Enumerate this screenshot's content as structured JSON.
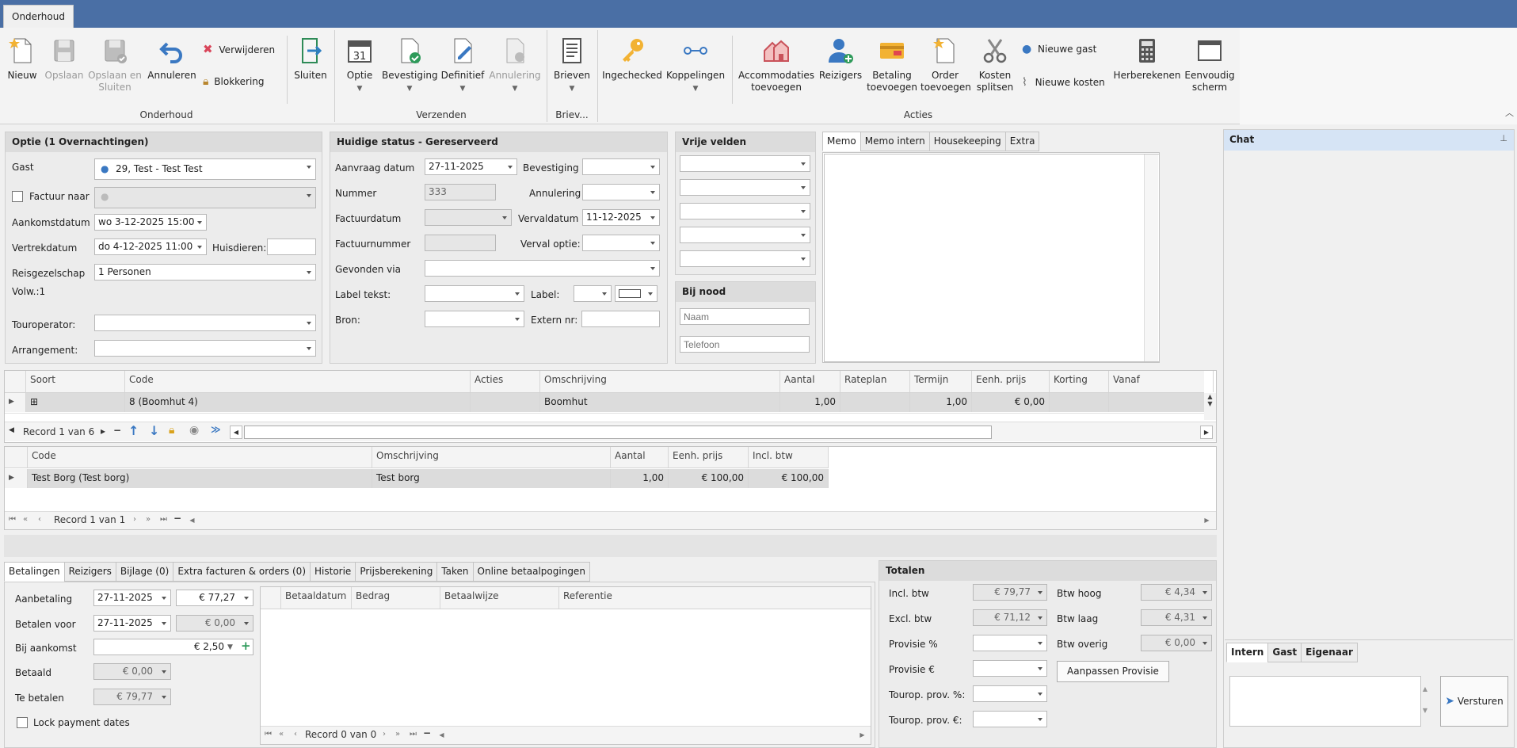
{
  "window": {
    "tab": "Onderhoud"
  },
  "ribbon": {
    "groups": {
      "onderhoud": "Onderhoud",
      "verzenden": "Verzenden",
      "brieven": "Briev...",
      "acties": "Acties"
    },
    "nieuw": "Nieuw",
    "opslaan": "Opslaan",
    "opslaan_sluiten_1": "Opslaan en",
    "opslaan_sluiten_2": "Sluiten",
    "annuleren": "Annuleren",
    "verwijderen": "Verwijderen",
    "blokkering": "Blokkering",
    "sluiten": "Sluiten",
    "optie": "Optie",
    "bevestiging": "Bevestiging",
    "definitief": "Definitief",
    "annulering": "Annulering",
    "brieven": "Brieven",
    "ingechecked": "Ingechecked",
    "koppelingen": "Koppelingen",
    "accommodaties_1": "Accommodaties",
    "accommodaties_2": "toevoegen",
    "reizigers": "Reizigers",
    "betaling_1": "Betaling",
    "betaling_2": "toevoegen",
    "order_1": "Order",
    "order_2": "toevoegen",
    "kosten_1": "Kosten",
    "kosten_2": "splitsen",
    "nieuwe_gast": "Nieuwe gast",
    "nieuwe_kosten": "Nieuwe kosten",
    "herberekenen": "Herberekenen",
    "eenvoudig_1": "Eenvoudig",
    "eenvoudig_2": "scherm"
  },
  "optie": {
    "title": "Optie (1 Overnachtingen)",
    "gast_label": "Gast",
    "gast_value": "29, Test - Test Test",
    "factuur_label": "Factuur naar",
    "aankomst_label": "Aankomstdatum",
    "aankomst_value": "wo 3-12-2025 15:00",
    "vertrek_label": "Vertrekdatum",
    "vertrek_value": "do 4-12-2025 11:00",
    "huisdieren_label": "Huisdieren:",
    "reis_label": "Reisgezelschap",
    "reis_value": "1 Personen",
    "volw": "Volw.:1",
    "touroperator_label": "Touroperator:",
    "arrangement_label": "Arrangement:"
  },
  "status": {
    "title": "Huidige status - Gereserveerd",
    "aanvraag_label": "Aanvraag datum",
    "aanvraag_value": "27-11-2025",
    "bevestiging_label": "Bevestiging",
    "nummer_label": "Nummer",
    "nummer_value": "333",
    "annulering_label": "Annulering",
    "factuurdatum_label": "Factuurdatum",
    "vervaldatum_label": "Vervaldatum",
    "vervaldatum_value": "11-12-2025",
    "factuurnummer_label": "Factuurnummer",
    "verval_optie_label": "Verval optie:",
    "gevonden_label": "Gevonden via",
    "label_tekst_label": "Label tekst:",
    "label_label": "Label:",
    "bron_label": "Bron:",
    "extern_label": "Extern nr:"
  },
  "vrije": {
    "title": "Vrije velden"
  },
  "nood": {
    "title": "Bij nood",
    "naam_placeholder": "Naam",
    "telefoon_placeholder": "Telefoon"
  },
  "memo": {
    "tabs": [
      "Memo",
      "Memo intern",
      "Housekeeping",
      "Extra"
    ]
  },
  "grid1": {
    "headers": [
      "Soort",
      "Code",
      "Acties",
      "Omschrijving",
      "Aantal",
      "Rateplan",
      "Termijn",
      "Eenh. prijs",
      "Korting",
      "Vanaf"
    ],
    "row": {
      "code": "8 (Boomhut 4)",
      "omschrijving": "Boomhut",
      "aantal": "1,00",
      "termijn": "1,00",
      "prijs": "€ 0,00"
    },
    "record": "Record 1 van 6"
  },
  "grid2": {
    "headers": [
      "Code",
      "Omschrijving",
      "Aantal",
      "Eenh. prijs",
      "Incl. btw"
    ],
    "row": {
      "code": "Test Borg (Test borg)",
      "omschrijving": "Test borg",
      "aantal": "1,00",
      "prijs": "€ 100,00",
      "incl": "€ 100,00"
    },
    "record": "Record 1 van 1"
  },
  "bottom_tabs": [
    "Betalingen",
    "Reizigers",
    "Bijlage (0)",
    "Extra facturen & orders (0)",
    "Historie",
    "Prijsberekening",
    "Taken",
    "Online betaalpogingen"
  ],
  "betalingen": {
    "aanbetaling_label": "Aanbetaling",
    "aanbetaling_date": "27-11-2025",
    "aanbetaling_amount": "€ 77,27",
    "betalen_voor_label": "Betalen voor",
    "betalen_voor_date": "27-11-2025",
    "betalen_voor_amount": "€ 0,00",
    "bij_aankomst_label": "Bij aankomst",
    "bij_aankomst_amount": "€ 2,50",
    "betaald_label": "Betaald",
    "betaald_amount": "€ 0,00",
    "te_betalen_label": "Te betalen",
    "te_betalen_amount": "€ 79,77",
    "lock_label": "Lock payment dates",
    "headers": [
      "Betaaldatum",
      "Bedrag",
      "Betaalwijze",
      "Referentie"
    ],
    "record": "Record 0 van 0"
  },
  "totalen": {
    "title": "Totalen",
    "incl_label": "Incl. btw",
    "incl_value": "€ 79,77",
    "excl_label": "Excl. btw",
    "excl_value": "€ 71,12",
    "provisie_pct_label": "Provisie %",
    "provisie_eur_label": "Provisie €",
    "tourop_pct_label": "Tourop. prov. %:",
    "tourop_eur_label": "Tourop. prov. €:",
    "btw_hoog_label": "Btw hoog",
    "btw_hoog_value": "€ 4,34",
    "btw_laag_label": "Btw laag",
    "btw_laag_value": "€ 4,31",
    "btw_overig_label": "Btw overig",
    "btw_overig_value": "€ 0,00",
    "aanpassen": "Aanpassen Provisie"
  },
  "chat": {
    "title": "Chat",
    "tabs": [
      "Intern",
      "Gast",
      "Eigenaar"
    ],
    "send": "Versturen"
  }
}
